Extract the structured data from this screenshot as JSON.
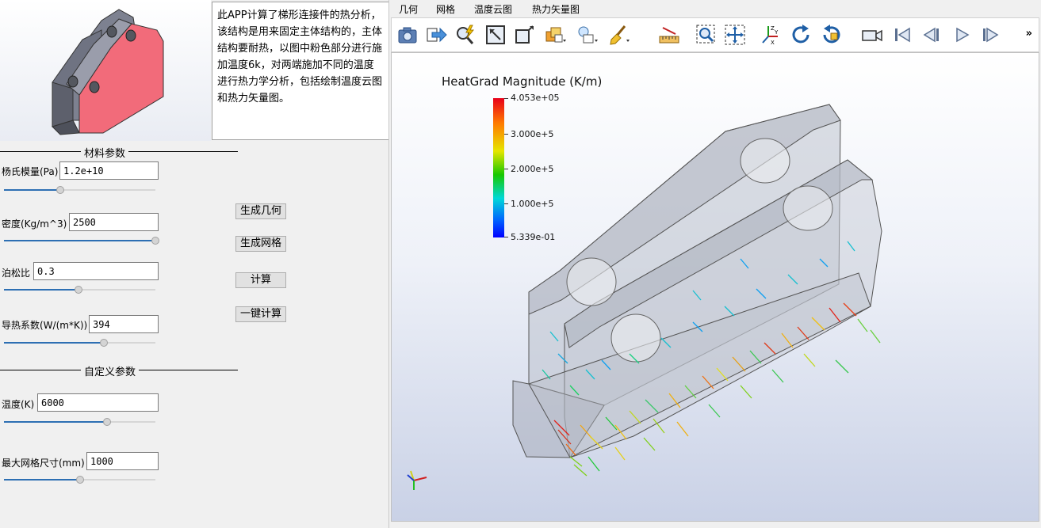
{
  "description": "此APP计算了梯形连接件的热分析， 该结构是用来固定主体结构的，主体结构要耐热，以图中粉色部分进行施加温度6k，对两端施加不同的温度进行热力学分析，包括绘制温度云图和热力矢量图。",
  "material_group": {
    "title": "材料参数",
    "youngs_label": "杨氏模量(Pa)",
    "youngs_value": "1.2e+10",
    "youngs_slider": 0.37,
    "density_label": "密度(Kg/m^3)",
    "density_value": "2500",
    "density_slider": 1.0,
    "poisson_label": "泊松比",
    "poisson_value": "0.3",
    "poisson_slider": 0.49,
    "conductivity_label": "导热系数(W/(m*K))",
    "conductivity_value": "394",
    "conductivity_slider": 0.66
  },
  "custom_group": {
    "title": "自定义参数",
    "temp_label": "温度(K)",
    "temp_value": "6000",
    "temp_slider": 0.68,
    "mesh_label": "最大网格尺寸(mm)",
    "mesh_value": "1000",
    "mesh_slider": 0.5
  },
  "buttons": {
    "gen_geometry": "生成几何",
    "gen_mesh": "生成网格",
    "compute": "计算",
    "one_click": "一键计算"
  },
  "tabs": [
    "几何",
    "网格",
    "温度云图",
    "热力矢量图"
  ],
  "toolbar": {
    "icons": [
      "camera-icon",
      "export-arrow-icon",
      "zoom-lightning-icon",
      "fit-view-icon",
      "box-view-icon",
      "color-layers-icon",
      "light-icon",
      "broom-icon",
      "ruler-icon",
      "zoom-box-icon",
      "pan-icon",
      "axes-icon",
      "rotate-cw-icon",
      "rotate-ccw-icon",
      "video-camera-icon",
      "first-frame-icon",
      "prev-frame-icon",
      "play-icon",
      "next-frame-icon"
    ],
    "more": "»"
  },
  "colorbar": {
    "title": "HeatGrad Magnitude (K/m)",
    "labels": [
      "4.053e+05",
      "3.000e+5",
      "2.000e+5",
      "1.000e+5",
      "5.339e-01"
    ]
  },
  "colors": {
    "accent": "#2d6fb3",
    "pink": "#f36b7a"
  }
}
